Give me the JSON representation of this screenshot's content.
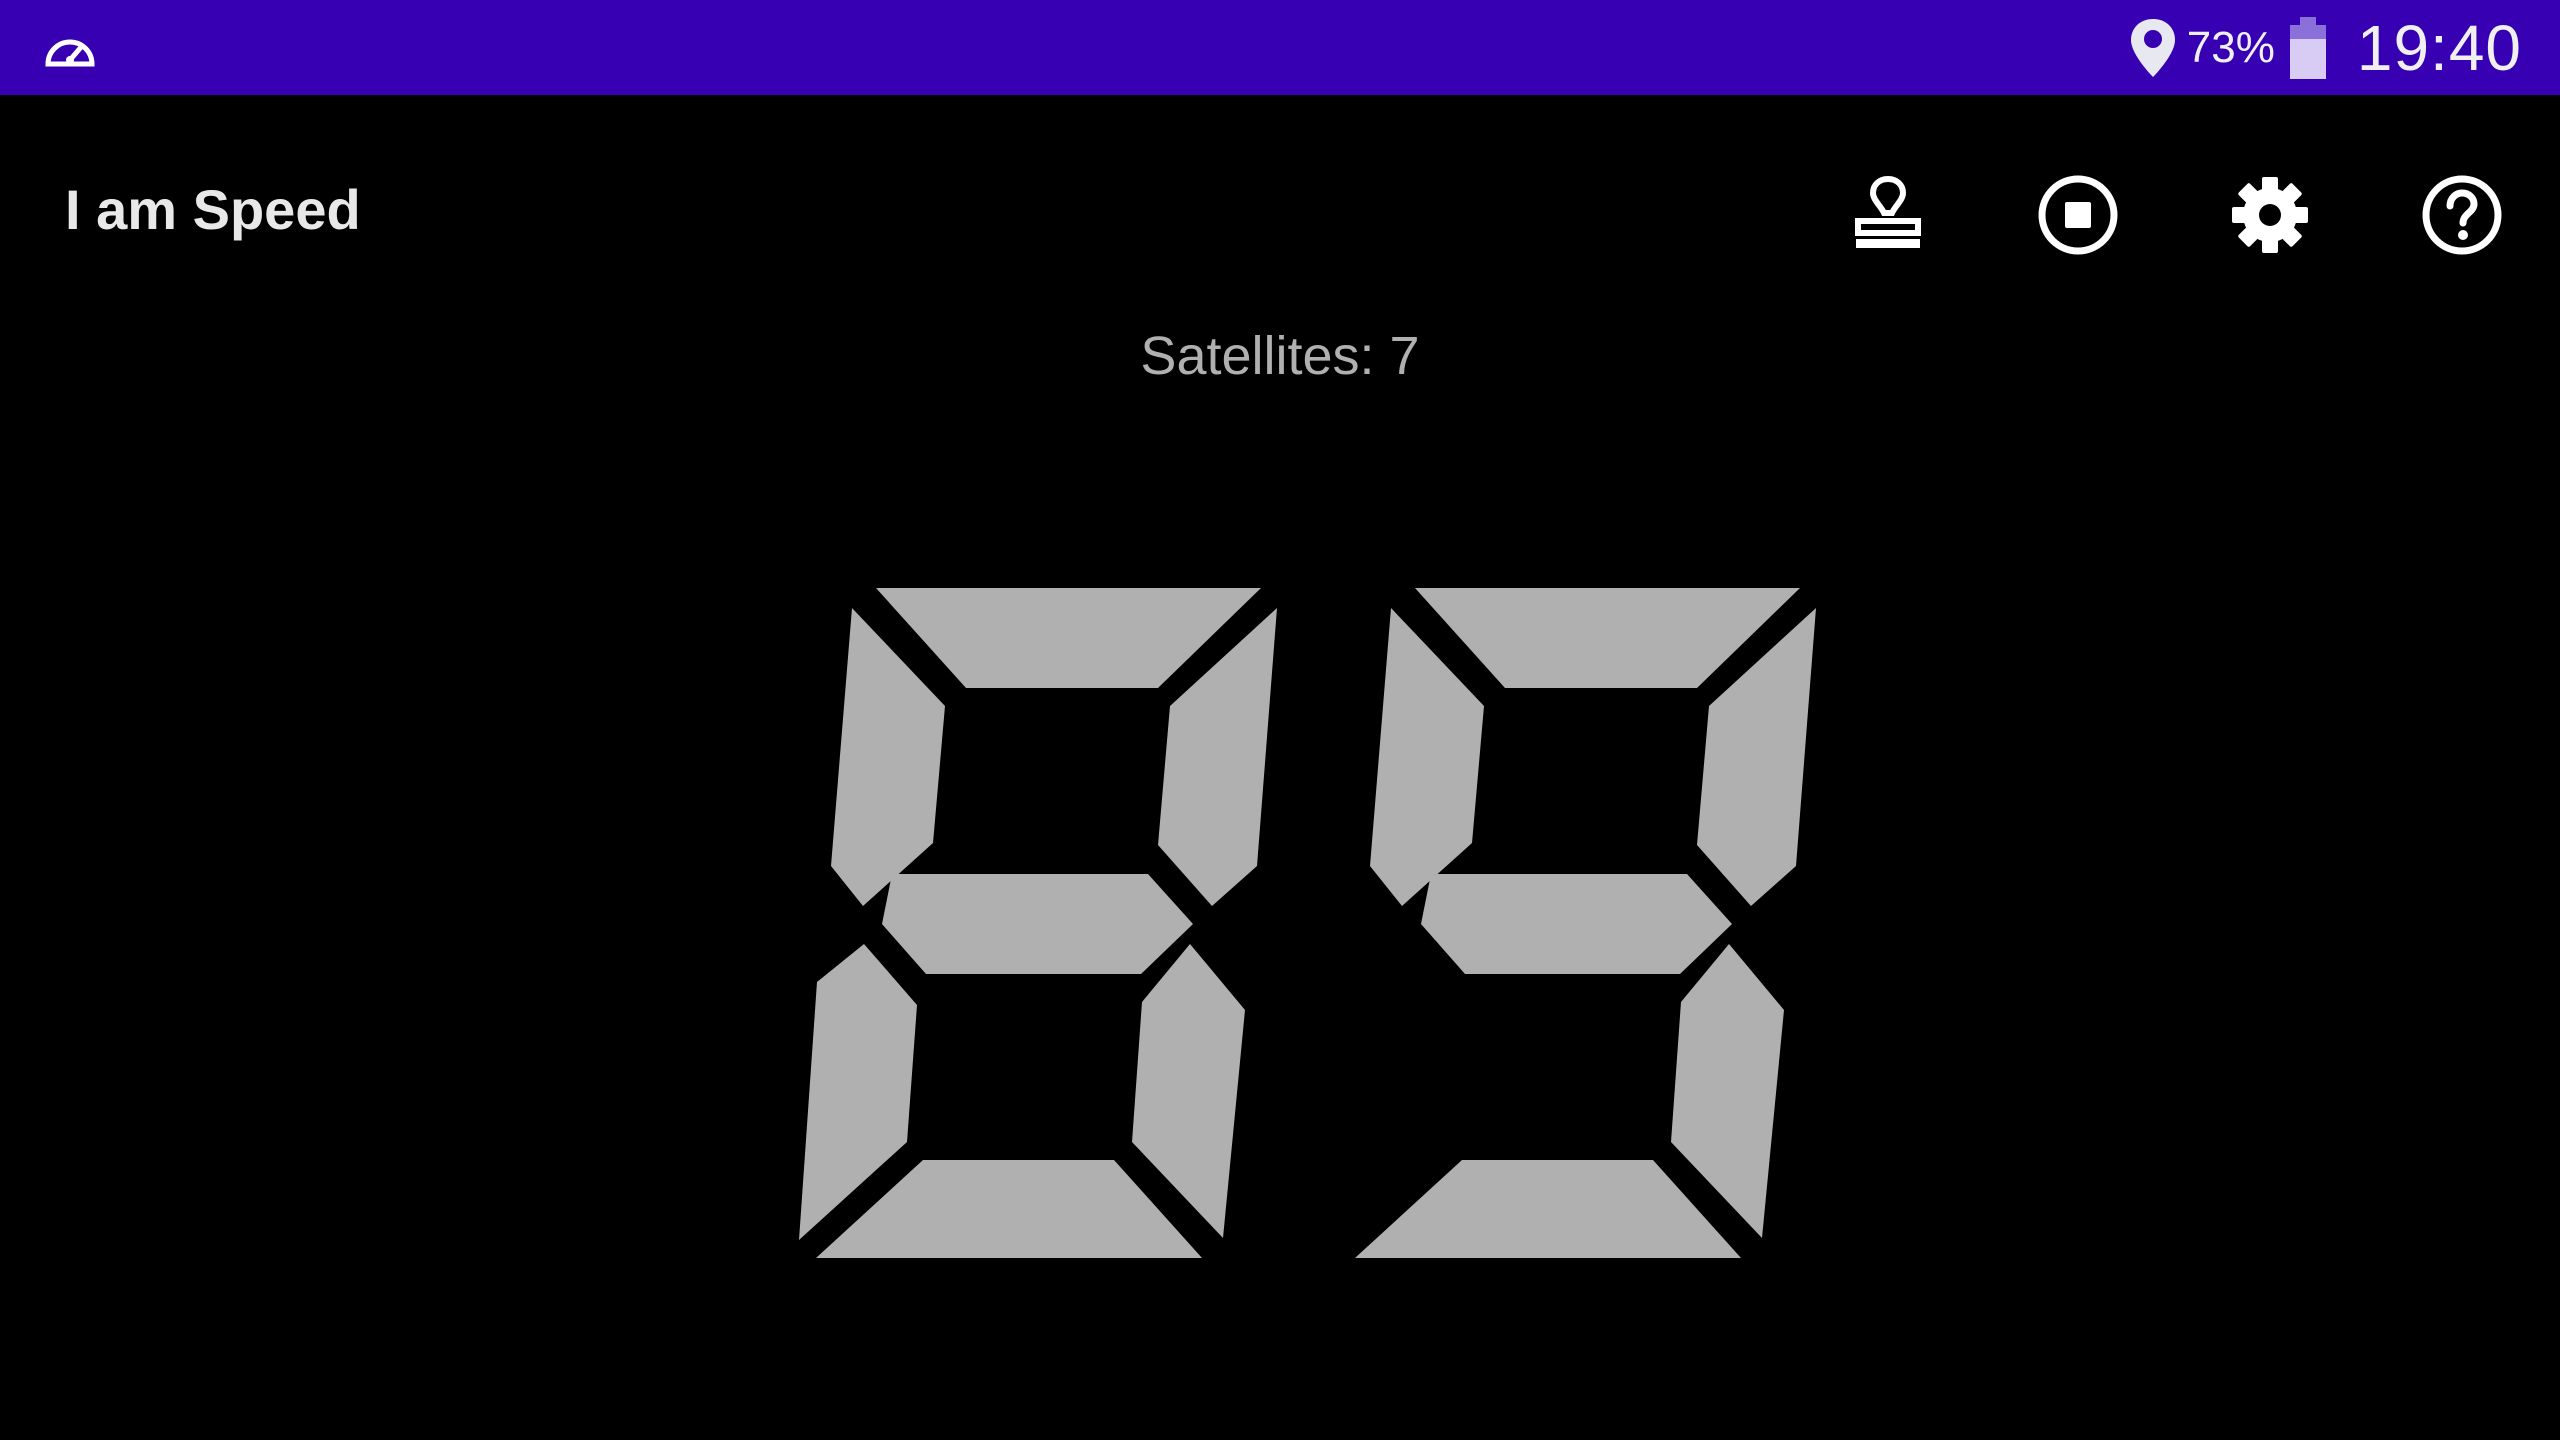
{
  "status_bar": {
    "app_icon": "speedometer-icon",
    "location_icon": "location-pin-icon",
    "battery_percent": "73%",
    "battery_icon": "battery-icon",
    "time": "19:40"
  },
  "app_bar": {
    "title": "I am Speed",
    "actions": [
      {
        "name": "stamp-icon"
      },
      {
        "name": "stop-icon"
      },
      {
        "name": "gear-icon"
      },
      {
        "name": "help-icon"
      }
    ]
  },
  "satellites": {
    "label": "Satellites: 7"
  },
  "speed": {
    "value": "89",
    "digits": [
      "8",
      "9"
    ]
  },
  "colors": {
    "status_bar": "#3700b3",
    "background": "#000000",
    "segment_on": "#b0b0b0",
    "title_text": "#e8e8e8"
  }
}
